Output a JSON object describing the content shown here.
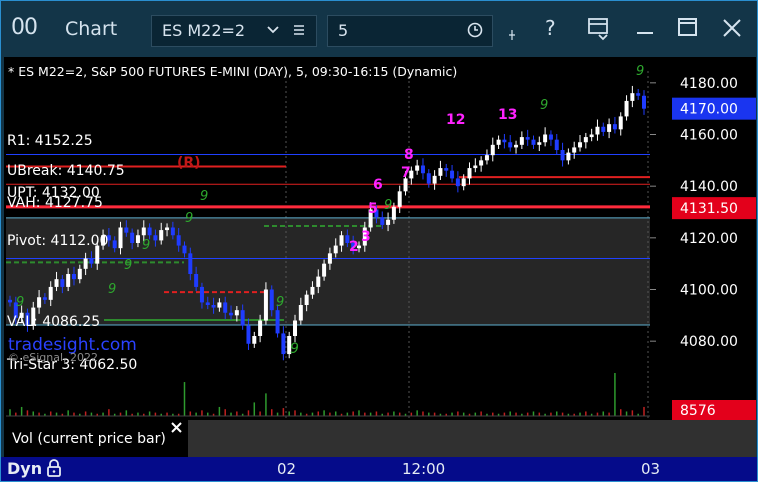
{
  "window": {
    "icon": "00",
    "title": "Chart",
    "symbol": "ES M22=2",
    "interval": "5",
    "controls": {
      "help": "?"
    }
  },
  "chart": {
    "header": "* ES M22=2, S&P 500 FUTURES E-MINI (DAY), 5, 09:30-16:15 (Dynamic)",
    "levels": [
      {
        "label": "R1: 4152.25"
      },
      {
        "label": "UBreak: 4140.75"
      },
      {
        "label": "UPT: 4132.00"
      },
      {
        "label": "VAH: 4127.75"
      },
      {
        "label": "Pivot: 4112.00"
      },
      {
        "label": "VAL: 4086.25"
      },
      {
        "label": "Tri-Star 3: 4062.50"
      }
    ],
    "rejection_marker": "(R)",
    "watermark": "tradesight.com",
    "copyright": "© eSignal, 2022",
    "price_ticks": [
      "4180.00",
      "4160.00",
      "4140.00",
      "4120.00",
      "4100.00",
      "4080.00"
    ],
    "last_price": "4170.00",
    "marker_price": "4131.50",
    "colors": {
      "last_price_bg": "#1a35f0",
      "marker_price_bg": "#e3001b",
      "candle_up": "#ffffff",
      "candle_down": "#1f3cff",
      "count_label": "#ff22ff"
    },
    "count_labels": [
      "2",
      "3",
      "5",
      "6",
      "7",
      "8",
      "12",
      "13"
    ],
    "setup_labels": [
      "9",
      "9",
      "9",
      "9",
      "9",
      "9",
      "9",
      "9",
      "9"
    ],
    "chart_data": {
      "type": "candlestick",
      "ylim": [
        4070,
        4190
      ],
      "series": [
        {
          "values": [
            4095,
            4089,
            4091,
            4086,
            4093,
            4097,
            4096,
            4101,
            4104,
            4101,
            4106,
            4104,
            4108,
            4112,
            4110,
            4117,
            4121,
            4119,
            4116,
            4124,
            4122,
            4118,
            4121,
            4124,
            4121,
            4119,
            4123,
            4124,
            4121,
            4117,
            4114,
            4106,
            4101,
            4095,
            4094,
            4093,
            4095,
            4091,
            4090,
            4092,
            4086,
            4079,
            4082,
            4088,
            4100,
            4092,
            4083,
            4075,
            4082,
            4088,
            4094,
            4098,
            4101,
            4105,
            4110,
            4114,
            4117,
            4121,
            4118,
            4116,
            4117,
            4124,
            4131,
            4128,
            4125,
            4127,
            4132,
            4138,
            4143,
            4146,
            4148,
            4145,
            4141,
            4144,
            4147,
            4146,
            4143,
            4140,
            4143,
            4147,
            4148,
            4150,
            4152,
            4156,
            4158,
            4157,
            4155,
            4156,
            4159,
            4158,
            4156,
            4157,
            4160,
            4158,
            4154,
            4150,
            4153,
            4155,
            4157,
            4159,
            4160,
            4163,
            4161,
            4164,
            4162,
            4167,
            4173,
            4176,
            4175,
            4170
          ]
        }
      ]
    },
    "volume": {
      "legend": "Vol (current price bar)",
      "last": "8576",
      "values": [
        6,
        3,
        8,
        5,
        4,
        3,
        2,
        4,
        3,
        2,
        5,
        3,
        2,
        4,
        3,
        2,
        3,
        6,
        2,
        3,
        5,
        2,
        3,
        2,
        4,
        3,
        2,
        3,
        2,
        2,
        30,
        4,
        3,
        5,
        3,
        2,
        8,
        6,
        3,
        4,
        2,
        5,
        12,
        4,
        20,
        6,
        3,
        7,
        4,
        5,
        3,
        2,
        3,
        4,
        5,
        3,
        4,
        2,
        3,
        4,
        5,
        3,
        3,
        4,
        2,
        3,
        4,
        3,
        2,
        3,
        5,
        4,
        3,
        3,
        2,
        2,
        3,
        4,
        3,
        2,
        3,
        4,
        2,
        3,
        2,
        3,
        4,
        3,
        2,
        3,
        4,
        3,
        2,
        3,
        4,
        3,
        2,
        2,
        3,
        4,
        2,
        3,
        4,
        3,
        38,
        6,
        4,
        5,
        2,
        8
      ]
    },
    "time_labels": [
      "02",
      "12:00",
      "03"
    ]
  },
  "statusbar": {
    "mode": "Dyn"
  }
}
